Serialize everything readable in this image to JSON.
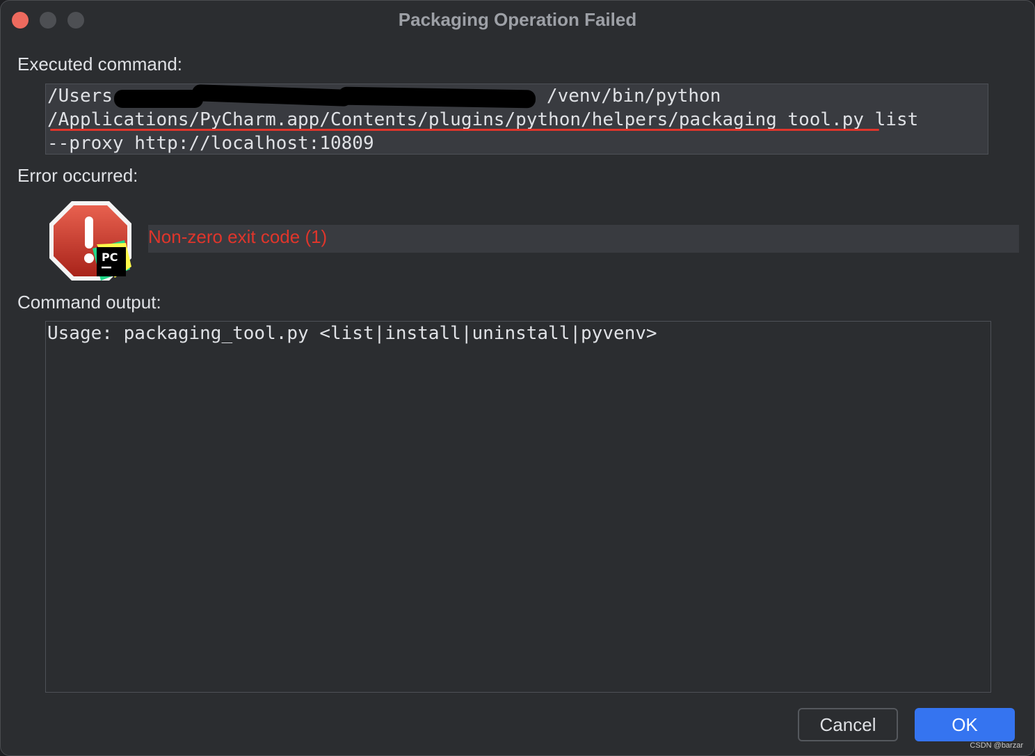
{
  "window": {
    "title": "Packaging Operation Failed"
  },
  "executed": {
    "label": "Executed command:",
    "line1_prefix": "/Users",
    "line1_suffix": "/venv/bin/python",
    "line2": "/Applications/PyCharm.app/Contents/plugins/python/helpers/packaging_tool.py list",
    "line3": "--proxy http://localhost:10809"
  },
  "error": {
    "label": "Error occurred:",
    "message": "Non-zero exit code (1)",
    "icon": "error-stop-icon",
    "badge": "PC"
  },
  "output": {
    "label": "Command output:",
    "text": "Usage: packaging_tool.py <list|install|uninstall|pyvenv>"
  },
  "buttons": {
    "cancel": "Cancel",
    "ok": "OK"
  },
  "watermark": "CSDN @barzar",
  "colors": {
    "error": "#e0352b",
    "primary": "#3574f0",
    "background": "#2b2d30"
  }
}
